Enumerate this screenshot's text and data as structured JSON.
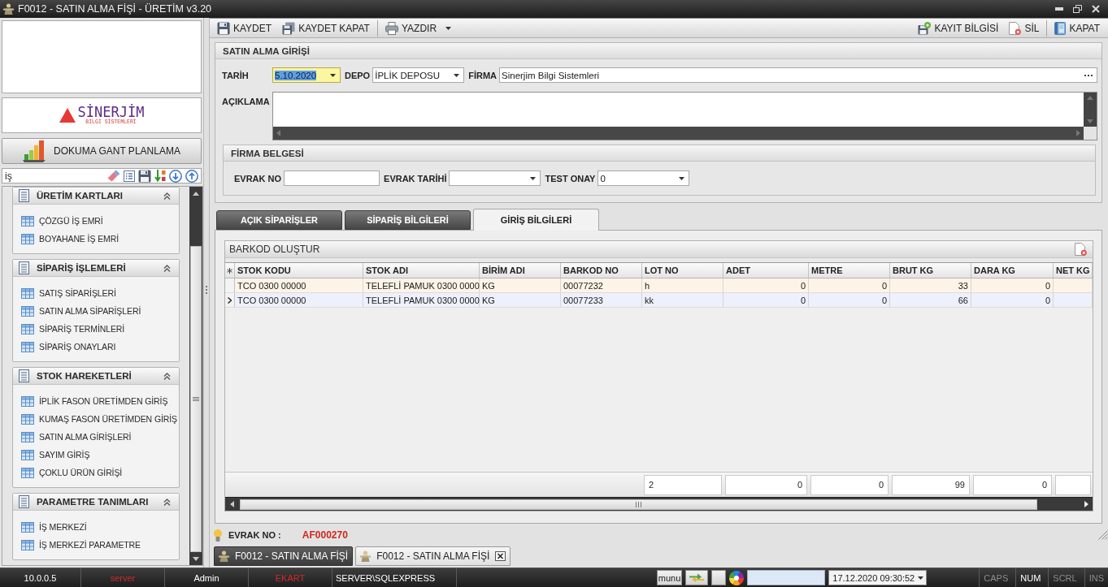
{
  "window": {
    "title": "F0012 - SATIN ALMA FİŞİ - ÜRETİM v3.20"
  },
  "sidebar": {
    "logo": {
      "name": "SİNERJİM",
      "tagline": "BİLGİ SİSTEMLERİ"
    },
    "gantt_button": {
      "label": "DOKUMA GANT PLANLAMA"
    },
    "search": {
      "value": "iş"
    },
    "groups": [
      {
        "title": "ÜRETİM KARTLARI",
        "expanded": true,
        "items": [
          "ÇÖZGÜ İŞ EMRİ",
          "BOYAHANE İŞ EMRİ"
        ]
      },
      {
        "title": "SİPARİŞ İŞLEMLERİ",
        "expanded": true,
        "items": [
          "SATIŞ SİPARİŞLERİ",
          "SATIN ALMA SİPARİŞLERİ",
          "SİPARİŞ TERMİNLERİ",
          "SİPARİŞ ONAYLARI"
        ]
      },
      {
        "title": "STOK HAREKETLERİ",
        "expanded": true,
        "items": [
          "İPLİK FASON ÜRETİMDEN GİRİŞ",
          "KUMAŞ FASON ÜRETİMDEN GİRİŞ",
          "SATIN ALMA GİRİŞLERİ",
          "SAYIM GİRİŞ",
          "ÇOKLU ÜRÜN GİRİŞİ"
        ]
      },
      {
        "title": "PARAMETRE TANIMLARI",
        "expanded": true,
        "items": [
          "İŞ MERKEZİ",
          "İŞ MERKEZİ PARAMETRE"
        ]
      }
    ]
  },
  "toolbar": {
    "left": [
      {
        "items": [
          {
            "label": "KAYDET",
            "kind": "save",
            "dropdown": false
          },
          {
            "label": "KAYDET KAPAT",
            "kind": "save_close",
            "dropdown": false
          }
        ]
      },
      {
        "items": [
          {
            "label": "YAZDIR",
            "kind": "print",
            "dropdown": true
          }
        ]
      }
    ],
    "right": [
      {
        "items": [
          {
            "label": "KAYIT BİLGİSİ",
            "kind": "record_info",
            "dropdown": false
          },
          {
            "label": "SİL",
            "kind": "delete",
            "dropdown": false
          }
        ]
      },
      {
        "items": [
          {
            "label": "KAPAT",
            "kind": "close",
            "dropdown": false
          }
        ]
      }
    ]
  },
  "entry_form": {
    "title": "SATIN ALMA GİRİŞİ",
    "fields": [
      {
        "label": "TARİH",
        "kind": "date",
        "value": "5.10.2020",
        "focused": true
      },
      {
        "label": "DEPO",
        "kind": "dropdown",
        "value": "İPLİK DEPOSU",
        "focused": false
      },
      {
        "label": "FİRMA",
        "kind": "lookup",
        "value": "Sinerjim Bilgi Sistemleri",
        "focused": false
      }
    ],
    "notes": {
      "label": "AÇIKLAMA"
    },
    "document": {
      "title": "FİRMA BELGESİ",
      "fields": [
        {
          "label": "EVRAK NO",
          "kind": "text"
        },
        {
          "label": "EVRAK TARİHİ",
          "kind": "dropdown"
        },
        {
          "label": "TEST ONAY",
          "kind": "dropdown",
          "value": "0"
        }
      ]
    }
  },
  "tabs": [
    {
      "label": "AÇIK SİPARİŞLER",
      "selected": false
    },
    {
      "label": "SİPARİŞ BİLGİLERİ",
      "selected": false
    },
    {
      "label": "GİRİŞ BİLGİLERİ",
      "selected": true
    }
  ],
  "barcode_panel": {
    "title": "BARKOD OLUŞTUR",
    "columns": [
      {
        "title": "STOK KODU",
        "kind": "text",
        "summary": false
      },
      {
        "title": "STOK ADI",
        "kind": "text",
        "summary": false
      },
      {
        "title": "BİRİM ADI",
        "kind": "text",
        "summary": false
      },
      {
        "title": "BARKOD NO",
        "kind": "text",
        "summary": false
      },
      {
        "title": "LOT NO",
        "kind": "text",
        "summary": true
      },
      {
        "title": "ADET",
        "kind": "number",
        "summary": true
      },
      {
        "title": "METRE",
        "kind": "number",
        "summary": true
      },
      {
        "title": "BRUT KG",
        "kind": "number",
        "summary": true
      },
      {
        "title": "DARA KG",
        "kind": "number",
        "summary": true
      },
      {
        "title": "NET KG",
        "kind": "number",
        "summary": true
      }
    ],
    "rows": [
      {
        "selected": false,
        "cells": [
          "TCO 0300 00000",
          "TELEFLİ PAMUK 0300 0000",
          "KG",
          "00077232",
          "h",
          "0",
          "0",
          "33",
          "0"
        ]
      },
      {
        "selected": true,
        "cells": [
          "TCO 0300 00000",
          "TELEFLİ PAMUK 0300 0000",
          "KG",
          "00077233",
          "kk",
          "0",
          "0",
          "66",
          "0"
        ]
      }
    ],
    "totals": [
      "2",
      "0",
      "0",
      "99",
      "0"
    ]
  },
  "record_number": {
    "label": "EVRAK NO :",
    "value": "AF000270"
  },
  "document_tabs": [
    {
      "label": "F0012 - SATIN ALMA FİŞİ",
      "selected": false
    },
    {
      "label": "F0012 - SATIN ALMA FİŞİ",
      "selected": true
    }
  ],
  "status_bar": {
    "panels": [
      {
        "text": "10.0.0.5",
        "color": "#ffffff"
      },
      {
        "text": "server",
        "color": "#d42a2a"
      },
      {
        "text": "Admin",
        "color": "#ffffff"
      },
      {
        "text": "EKART",
        "color": "#d42a2a"
      },
      {
        "text": "SERVER\\SQLEXPRESS",
        "color": "#ffffff"
      }
    ],
    "menu_button": "munu",
    "datetime": "17.12.2020 09:30:52",
    "indicators": [
      {
        "label": "CAPS",
        "on": false
      },
      {
        "label": "NUM",
        "on": true
      },
      {
        "label": "SCRL",
        "on": false
      },
      {
        "label": "INS",
        "on": false
      }
    ]
  }
}
